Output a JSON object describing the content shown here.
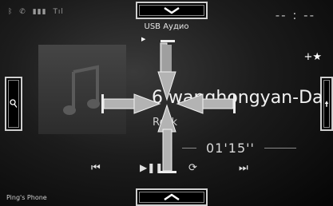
{
  "status": {
    "icons": [
      "bluetooth-icon",
      "phone-icon",
      "battery-icon",
      "signal-icon"
    ],
    "glyphs": [
      "ᛒ",
      "✆",
      "▮▮▮",
      "Tıl"
    ]
  },
  "clock": {
    "text": "-- : --"
  },
  "source": {
    "label": "USB Аудио"
  },
  "track": {
    "title": "6  wanghongyan-Da",
    "artist": "Rock",
    "elapsed": "01'15''"
  },
  "device": {
    "name": "Ping's Phone"
  },
  "controls": {
    "prev": "⏮",
    "play_pause": "▶❚❚",
    "next": "⏭",
    "repeat": "⟳"
  },
  "favorite": {
    "label": "+★"
  }
}
